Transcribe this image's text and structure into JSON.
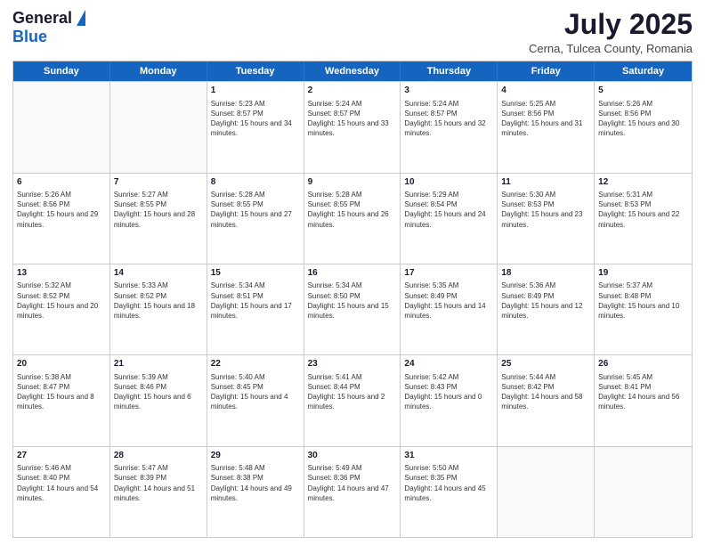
{
  "header": {
    "logo_general": "General",
    "logo_blue": "Blue",
    "title": "July 2025",
    "subtitle": "Cerna, Tulcea County, Romania"
  },
  "calendar": {
    "weekdays": [
      "Sunday",
      "Monday",
      "Tuesday",
      "Wednesday",
      "Thursday",
      "Friday",
      "Saturday"
    ],
    "rows": [
      [
        {
          "day": "",
          "sunrise": "",
          "sunset": "",
          "daylight": ""
        },
        {
          "day": "",
          "sunrise": "",
          "sunset": "",
          "daylight": ""
        },
        {
          "day": "1",
          "sunrise": "Sunrise: 5:23 AM",
          "sunset": "Sunset: 8:57 PM",
          "daylight": "Daylight: 15 hours and 34 minutes."
        },
        {
          "day": "2",
          "sunrise": "Sunrise: 5:24 AM",
          "sunset": "Sunset: 8:57 PM",
          "daylight": "Daylight: 15 hours and 33 minutes."
        },
        {
          "day": "3",
          "sunrise": "Sunrise: 5:24 AM",
          "sunset": "Sunset: 8:57 PM",
          "daylight": "Daylight: 15 hours and 32 minutes."
        },
        {
          "day": "4",
          "sunrise": "Sunrise: 5:25 AM",
          "sunset": "Sunset: 8:56 PM",
          "daylight": "Daylight: 15 hours and 31 minutes."
        },
        {
          "day": "5",
          "sunrise": "Sunrise: 5:26 AM",
          "sunset": "Sunset: 8:56 PM",
          "daylight": "Daylight: 15 hours and 30 minutes."
        }
      ],
      [
        {
          "day": "6",
          "sunrise": "Sunrise: 5:26 AM",
          "sunset": "Sunset: 8:56 PM",
          "daylight": "Daylight: 15 hours and 29 minutes."
        },
        {
          "day": "7",
          "sunrise": "Sunrise: 5:27 AM",
          "sunset": "Sunset: 8:55 PM",
          "daylight": "Daylight: 15 hours and 28 minutes."
        },
        {
          "day": "8",
          "sunrise": "Sunrise: 5:28 AM",
          "sunset": "Sunset: 8:55 PM",
          "daylight": "Daylight: 15 hours and 27 minutes."
        },
        {
          "day": "9",
          "sunrise": "Sunrise: 5:28 AM",
          "sunset": "Sunset: 8:55 PM",
          "daylight": "Daylight: 15 hours and 26 minutes."
        },
        {
          "day": "10",
          "sunrise": "Sunrise: 5:29 AM",
          "sunset": "Sunset: 8:54 PM",
          "daylight": "Daylight: 15 hours and 24 minutes."
        },
        {
          "day": "11",
          "sunrise": "Sunrise: 5:30 AM",
          "sunset": "Sunset: 8:53 PM",
          "daylight": "Daylight: 15 hours and 23 minutes."
        },
        {
          "day": "12",
          "sunrise": "Sunrise: 5:31 AM",
          "sunset": "Sunset: 8:53 PM",
          "daylight": "Daylight: 15 hours and 22 minutes."
        }
      ],
      [
        {
          "day": "13",
          "sunrise": "Sunrise: 5:32 AM",
          "sunset": "Sunset: 8:52 PM",
          "daylight": "Daylight: 15 hours and 20 minutes."
        },
        {
          "day": "14",
          "sunrise": "Sunrise: 5:33 AM",
          "sunset": "Sunset: 8:52 PM",
          "daylight": "Daylight: 15 hours and 18 minutes."
        },
        {
          "day": "15",
          "sunrise": "Sunrise: 5:34 AM",
          "sunset": "Sunset: 8:51 PM",
          "daylight": "Daylight: 15 hours and 17 minutes."
        },
        {
          "day": "16",
          "sunrise": "Sunrise: 5:34 AM",
          "sunset": "Sunset: 8:50 PM",
          "daylight": "Daylight: 15 hours and 15 minutes."
        },
        {
          "day": "17",
          "sunrise": "Sunrise: 5:35 AM",
          "sunset": "Sunset: 8:49 PM",
          "daylight": "Daylight: 15 hours and 14 minutes."
        },
        {
          "day": "18",
          "sunrise": "Sunrise: 5:36 AM",
          "sunset": "Sunset: 8:49 PM",
          "daylight": "Daylight: 15 hours and 12 minutes."
        },
        {
          "day": "19",
          "sunrise": "Sunrise: 5:37 AM",
          "sunset": "Sunset: 8:48 PM",
          "daylight": "Daylight: 15 hours and 10 minutes."
        }
      ],
      [
        {
          "day": "20",
          "sunrise": "Sunrise: 5:38 AM",
          "sunset": "Sunset: 8:47 PM",
          "daylight": "Daylight: 15 hours and 8 minutes."
        },
        {
          "day": "21",
          "sunrise": "Sunrise: 5:39 AM",
          "sunset": "Sunset: 8:46 PM",
          "daylight": "Daylight: 15 hours and 6 minutes."
        },
        {
          "day": "22",
          "sunrise": "Sunrise: 5:40 AM",
          "sunset": "Sunset: 8:45 PM",
          "daylight": "Daylight: 15 hours and 4 minutes."
        },
        {
          "day": "23",
          "sunrise": "Sunrise: 5:41 AM",
          "sunset": "Sunset: 8:44 PM",
          "daylight": "Daylight: 15 hours and 2 minutes."
        },
        {
          "day": "24",
          "sunrise": "Sunrise: 5:42 AM",
          "sunset": "Sunset: 8:43 PM",
          "daylight": "Daylight: 15 hours and 0 minutes."
        },
        {
          "day": "25",
          "sunrise": "Sunrise: 5:44 AM",
          "sunset": "Sunset: 8:42 PM",
          "daylight": "Daylight: 14 hours and 58 minutes."
        },
        {
          "day": "26",
          "sunrise": "Sunrise: 5:45 AM",
          "sunset": "Sunset: 8:41 PM",
          "daylight": "Daylight: 14 hours and 56 minutes."
        }
      ],
      [
        {
          "day": "27",
          "sunrise": "Sunrise: 5:46 AM",
          "sunset": "Sunset: 8:40 PM",
          "daylight": "Daylight: 14 hours and 54 minutes."
        },
        {
          "day": "28",
          "sunrise": "Sunrise: 5:47 AM",
          "sunset": "Sunset: 8:39 PM",
          "daylight": "Daylight: 14 hours and 51 minutes."
        },
        {
          "day": "29",
          "sunrise": "Sunrise: 5:48 AM",
          "sunset": "Sunset: 8:38 PM",
          "daylight": "Daylight: 14 hours and 49 minutes."
        },
        {
          "day": "30",
          "sunrise": "Sunrise: 5:49 AM",
          "sunset": "Sunset: 8:36 PM",
          "daylight": "Daylight: 14 hours and 47 minutes."
        },
        {
          "day": "31",
          "sunrise": "Sunrise: 5:50 AM",
          "sunset": "Sunset: 8:35 PM",
          "daylight": "Daylight: 14 hours and 45 minutes."
        },
        {
          "day": "",
          "sunrise": "",
          "sunset": "",
          "daylight": ""
        },
        {
          "day": "",
          "sunrise": "",
          "sunset": "",
          "daylight": ""
        }
      ]
    ]
  }
}
